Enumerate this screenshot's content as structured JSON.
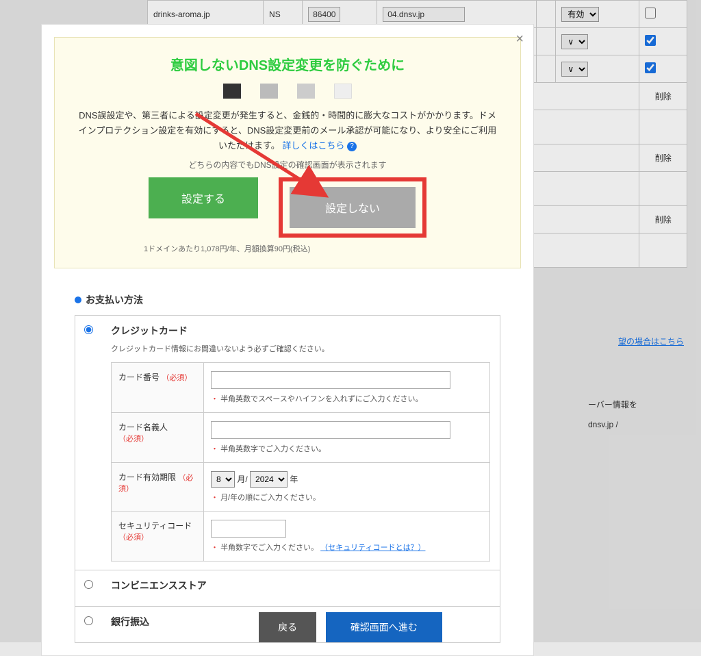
{
  "bg": {
    "domain": "drinks-aroma.jp",
    "rtype": "NS",
    "ttl": "86400",
    "value": "04.dnsv.jp",
    "status": "有効",
    "delete": "削除",
    "link": "望の場合はこちら",
    "server": "ーバー情報を",
    "dnsinfo": "dnsv.jp /"
  },
  "modal": {
    "promo_title": "意図しないDNS設定変更を防ぐために",
    "promo_body": "DNS誤設定や、第三者による設定変更が発生すると、金銭的・時間的に膨大なコストがかかります。ドメインプロテクション設定を有効にすると、DNS設定変更前のメール承認が可能になり、より安全にご利用いただけます。",
    "promo_linktext": "詳しくはこちら",
    "promo_note": "どちらの内容でもDNS設定の確認画面が表示されます",
    "btn_set": "設定する",
    "btn_noset": "設定しない",
    "price": "1ドメインあたり1,078円/年、月額換算90円(税込)"
  },
  "payment": {
    "section_title": "お支払い方法",
    "cc": {
      "title": "クレジットカード",
      "sub": "クレジットカード情報にお間違いないよう必ずご確認ください。",
      "card_no": "カード番号",
      "required": "（必須）",
      "hint_no": "半角英数でスペースやハイフンを入れずにご入力ください。",
      "holder": "カード名義人",
      "hint_holder": "半角英数字でご入力ください。",
      "expiry": "カード有効期限",
      "month": "8",
      "m_lbl": "月/",
      "year": "2024",
      "y_lbl": "年",
      "hint_expiry": "月/年の順にご入力ください。",
      "seccode": "セキュリティコード",
      "hint_sec": "半角数字でご入力ください。",
      "sec_link": "（セキュリティコードとは？）"
    },
    "cvs": "コンビニエンスストア",
    "bank": "銀行振込"
  },
  "footer": {
    "back": "戻る",
    "confirm": "確認画面へ進む"
  }
}
